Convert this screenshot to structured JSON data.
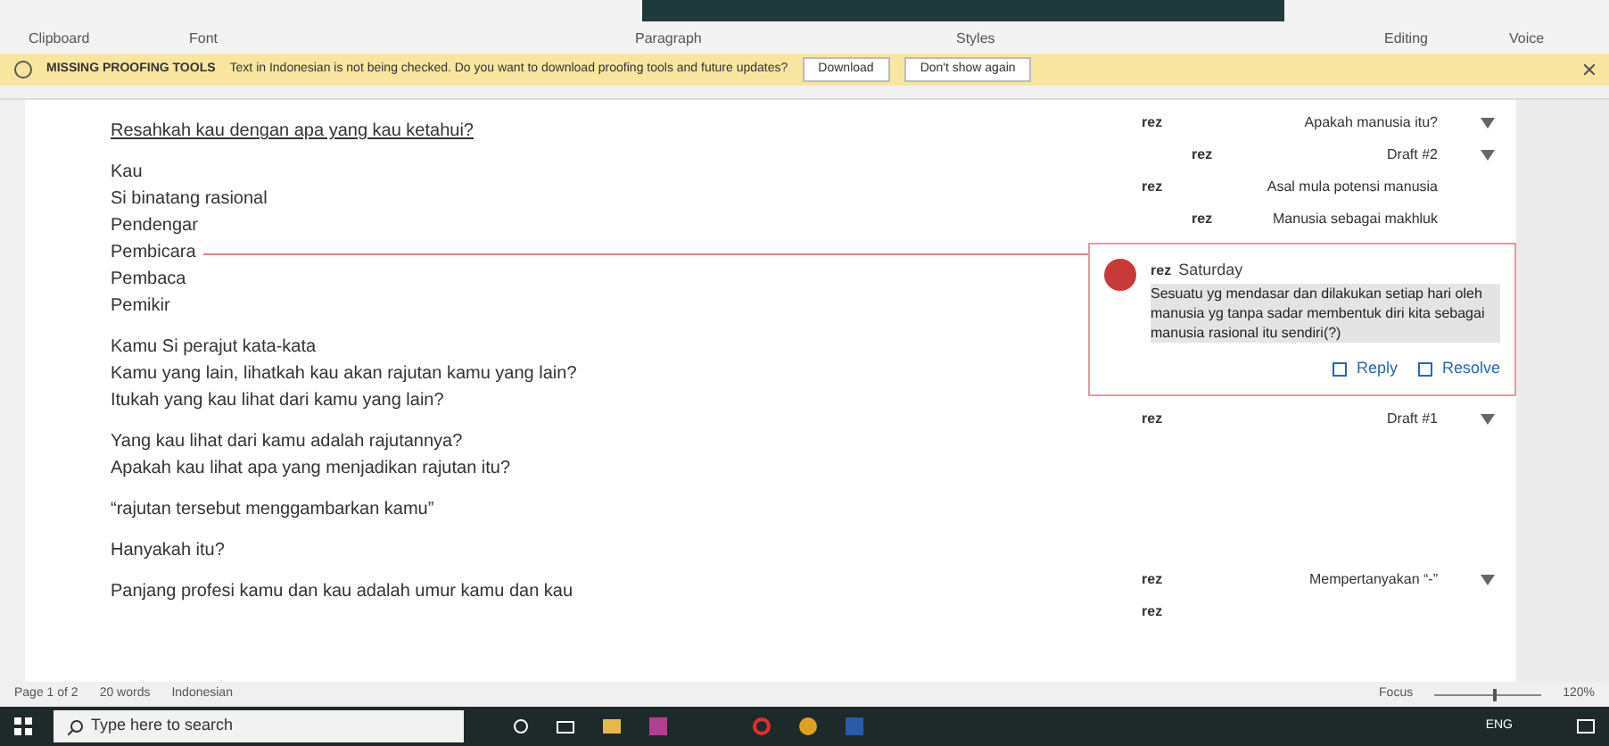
{
  "ribbon": {
    "groups": [
      "Clipboard",
      "Font",
      "Paragraph",
      "Styles",
      "Editing",
      "Voice"
    ]
  },
  "message_bar": {
    "title": "MISSING PROOFING TOOLS",
    "text": "Text in Indonesian is not being checked. Do you want to download proofing tools and future updates?",
    "buttons": [
      "Download",
      "Don't show again"
    ]
  },
  "document": {
    "blocks": [
      [
        "Resahkah kau dengan apa yang kau ketahui?"
      ],
      [
        "Kau",
        "Si binatang rasional",
        "Pendengar",
        "Pembicara",
        "Pembaca",
        "Pemikir"
      ],
      [
        "Kamu Si perajut kata-kata",
        "Kamu yang lain, lihatkah kau akan rajutan kamu yang lain?",
        "Itukah yang kau lihat dari kamu yang lain?"
      ],
      [
        "Yang kau lihat dari kamu adalah rajutannya?",
        "Apakah kau lihat apa yang menjadikan rajutan itu?"
      ],
      [
        "“rajutan tersebut menggambarkan kamu”"
      ],
      [
        "Hanyakah itu?"
      ],
      [
        "Panjang profesi kamu dan kau adalah umur kamu dan kau"
      ]
    ]
  },
  "comments": [
    {
      "kind": "collapsed",
      "author": "rez",
      "text": "Apakah manusia itu?",
      "menu": true,
      "children": [
        {
          "kind": "collapsed",
          "author": "rez",
          "text": "Draft #2",
          "menu": true
        }
      ]
    },
    {
      "kind": "collapsed",
      "author": "rez",
      "text": "Asal mula potensi manusia",
      "menu": false,
      "children": [
        {
          "kind": "collapsed",
          "author": "rez",
          "text": "Manusia sebagai makhluk",
          "menu": false
        }
      ]
    },
    {
      "kind": "expanded",
      "author": "rez",
      "time": "Saturday",
      "text": "Sesuatu yg mendasar dan dilakukan setiap hari oleh manusia yg tanpa sadar membentuk diri kita sebagai manusia rasional itu sendiri(?)",
      "actions": [
        "Reply",
        "Resolve"
      ]
    },
    {
      "kind": "collapsed",
      "author": "rez",
      "text": "Draft #1",
      "menu": true
    },
    {
      "kind": "collapsed",
      "author": "rez",
      "text": "Mempertanyakan “-”",
      "menu": true
    },
    {
      "kind": "collapsed",
      "author": "rez",
      "menu": false
    }
  ],
  "status_bar": {
    "page": "Page 1 of 2",
    "words": "20 words",
    "language": "Indonesian",
    "focus": "Focus",
    "zoom": "120%",
    "zoom_slider": {
      "level": 0.55
    }
  },
  "taskbar": {
    "search_placeholder": "Type here to search",
    "language": "ENG"
  }
}
